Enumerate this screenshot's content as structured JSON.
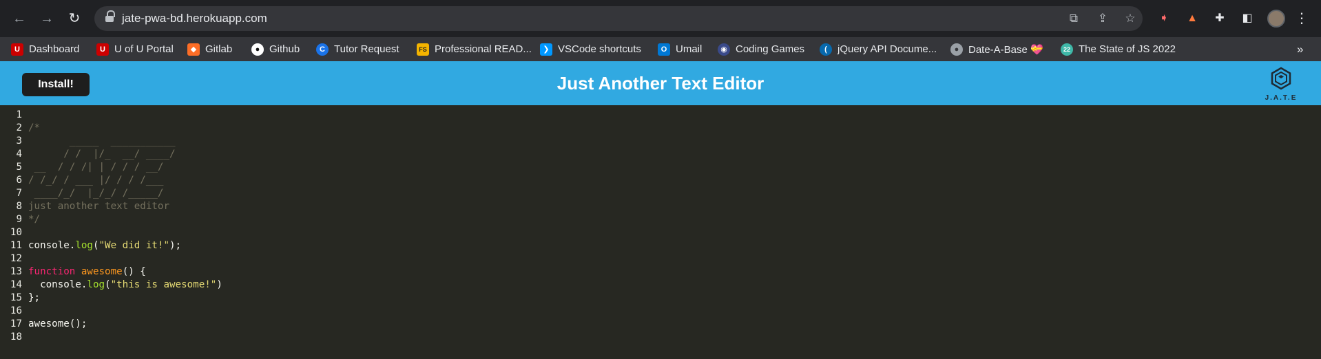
{
  "browser": {
    "url": "jate-pwa-bd.herokuapp.com",
    "bookmarks": [
      {
        "label": "Dashboard",
        "icon": "u-icon",
        "color": "#cc0000",
        "glyph": "U"
      },
      {
        "label": "U of U Portal",
        "icon": "u-icon",
        "color": "#cc0000",
        "glyph": "U"
      },
      {
        "label": "Gitlab",
        "icon": "gitlab-icon",
        "color": "#fc6d26",
        "glyph": "◆"
      },
      {
        "label": "Github",
        "icon": "github-icon",
        "color": "#ffffff",
        "glyph": "●"
      },
      {
        "label": "Tutor Request",
        "icon": "tutor-icon",
        "color": "#1a73e8",
        "glyph": "C"
      },
      {
        "label": "Professional READ...",
        "icon": "readme-icon",
        "color": "#f4b400",
        "glyph": "FS"
      },
      {
        "label": "VSCode shortcuts",
        "icon": "vscode-icon",
        "color": "#0098ff",
        "glyph": "❯"
      },
      {
        "label": "Umail",
        "icon": "outlook-icon",
        "color": "#0078d4",
        "glyph": "O"
      },
      {
        "label": "Coding Games",
        "icon": "codingame-icon",
        "color": "#3a4a8a",
        "glyph": "◉"
      },
      {
        "label": "jQuery API Docume...",
        "icon": "jquery-icon",
        "color": "#0769ad",
        "glyph": "("
      },
      {
        "label": "Date-A-Base 💝",
        "icon": "globe-icon",
        "color": "#9aa0a6",
        "glyph": "●"
      },
      {
        "label": "The State of JS 2022",
        "icon": "stateofjs-icon",
        "color": "#3fb8a8",
        "glyph": "22"
      }
    ],
    "more_label": "»"
  },
  "app": {
    "install_label": "Install!",
    "title": "Just Another Text Editor",
    "logo_text": "J.A.T.E"
  },
  "editor": {
    "lines": [
      {
        "n": "1",
        "tokens": []
      },
      {
        "n": "2",
        "tokens": [
          {
            "t": "comment",
            "v": "/*"
          }
        ]
      },
      {
        "n": "3",
        "tokens": [
          {
            "t": "comment",
            "v": "       _____  ___________"
          }
        ]
      },
      {
        "n": "4",
        "tokens": [
          {
            "t": "comment",
            "v": "      / /  |/_  __/ ____/"
          }
        ]
      },
      {
        "n": "5",
        "tokens": [
          {
            "t": "comment",
            "v": " __  / / /| | / / / __/"
          }
        ]
      },
      {
        "n": "6",
        "tokens": [
          {
            "t": "comment",
            "v": "/ /_/ / ___ |/ / / /___"
          }
        ]
      },
      {
        "n": "7",
        "tokens": [
          {
            "t": "comment",
            "v": " ____/_/  |_/_/ /_____/"
          }
        ]
      },
      {
        "n": "8",
        "tokens": [
          {
            "t": "comment",
            "v": "just another text editor"
          }
        ]
      },
      {
        "n": "9",
        "tokens": [
          {
            "t": "comment",
            "v": "*/"
          }
        ]
      },
      {
        "n": "10",
        "tokens": []
      },
      {
        "n": "11",
        "tokens": [
          {
            "t": "plain",
            "v": "console."
          },
          {
            "t": "prop",
            "v": "log"
          },
          {
            "t": "plain",
            "v": "("
          },
          {
            "t": "string",
            "v": "\"We did it!\""
          },
          {
            "t": "plain",
            "v": ");"
          }
        ]
      },
      {
        "n": "12",
        "tokens": []
      },
      {
        "n": "13",
        "tokens": [
          {
            "t": "keyword",
            "v": "function"
          },
          {
            "t": "plain",
            "v": " "
          },
          {
            "t": "fn",
            "v": "awesome"
          },
          {
            "t": "plain",
            "v": "() {"
          }
        ]
      },
      {
        "n": "14",
        "tokens": [
          {
            "t": "plain",
            "v": "  console."
          },
          {
            "t": "prop",
            "v": "log"
          },
          {
            "t": "plain",
            "v": "("
          },
          {
            "t": "string",
            "v": "\"this is awesome!\""
          },
          {
            "t": "plain",
            "v": ")"
          }
        ]
      },
      {
        "n": "15",
        "tokens": [
          {
            "t": "plain",
            "v": "};"
          }
        ]
      },
      {
        "n": "16",
        "tokens": []
      },
      {
        "n": "17",
        "tokens": [
          {
            "t": "plain",
            "v": "awesome();"
          }
        ]
      },
      {
        "n": "18",
        "tokens": []
      }
    ]
  },
  "colors": {
    "header": "#31a9e1",
    "editor_bg": "#272822",
    "comment": "#75715e",
    "string": "#e6db74",
    "keyword": "#f92672",
    "function": "#fd971f",
    "property": "#a6e22e"
  }
}
